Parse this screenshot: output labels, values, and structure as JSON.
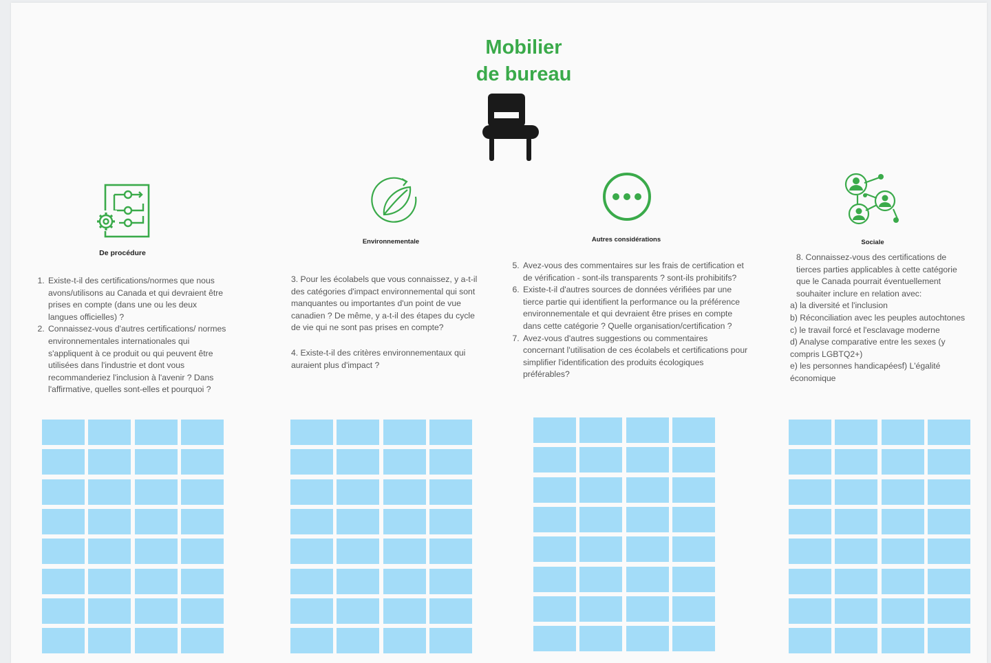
{
  "title": {
    "line1": "Mobilier",
    "line2": "de bureau"
  },
  "colors": {
    "accent": "#3aaa4a",
    "note": "#a3dcf8"
  },
  "icons": {
    "main": "office-chair-icon",
    "col1": "process-flow-gear-icon",
    "col2": "leaf-cycle-icon",
    "col3": "more-dots-icon",
    "col4": "social-network-icon"
  },
  "columns": [
    {
      "heading": "De procédure",
      "questions": [
        "Existe-t-il des certifications/normes que nous avons/utilisons au Canada et qui devraient être prises en compte (dans une ou les deux langues officielles) ?",
        "Connaissez-vous d'autres certifications/ normes environnementales internationales qui s'appliquent à ce produit ou qui peuvent être utilisées dans l'industrie et dont vous recommanderiez l'inclusion à l'avenir ? Dans l'affirmative, quelles sont-elles et pourquoi ?"
      ]
    },
    {
      "heading": "Environnementale",
      "questions": [
        "3. Pour les écolabels que vous connaissez, y a-t-il des catégories d'impact environnemental qui sont manquantes ou importantes d'un point de vue canadien ? De même, y a-t-il des étapes du cycle de vie qui ne sont pas prises en compte?",
        "4. Existe-t-il des critères environnementaux qui auraient plus d'impact ?"
      ]
    },
    {
      "heading": "Autres considérations",
      "questions": [
        "Avez-vous des commentaires sur les frais de certification et de vérification - sont-ils transparents ? sont-ils prohibitifs?",
        "Existe-t-il d'autres sources de données vérifiées par une tierce partie qui identifient la performance ou la préférence environnementale et qui devraient être prises en compte dans cette catégorie ? Quelle organisation/certification ?",
        "Avez-vous d'autres suggestions ou commentaires concernant l'utilisation de ces écolabels et certifications pour simplifier l'identification des produits écologiques préférables?"
      ]
    },
    {
      "heading": "Sociale",
      "intro": "8. Connaissez-vous des certifications de tierces parties applicables à cette catégorie que le Canada pourrait éventuellement souhaiter inclure en relation avec:",
      "items": [
        "a) la diversité et l'inclusion",
        "b) Réconciliation avec les peuples autochtones",
        "c) le travail forcé et l'esclavage moderne",
        "d) Analyse comparative entre les sexes (y compris LGBTQ2+)",
        "e) les personnes handicapéesf) L'égalité économique"
      ]
    }
  ]
}
